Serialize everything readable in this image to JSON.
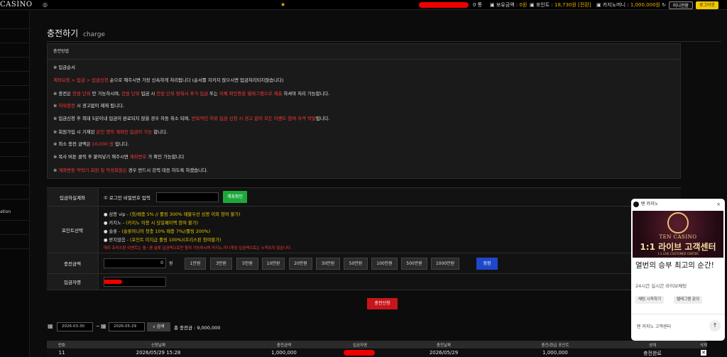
{
  "topbar": {
    "logo": "CASINO",
    "user_suffix": "0 통",
    "balance_label": "보유금액 :",
    "balance_value": "0원",
    "point_label": "포인트 :",
    "point_value": "18,730원 [전환]",
    "casino_label": "카지노머니 :",
    "casino_value": "1,000,000원",
    "mini_btn": "미니전환",
    "logout_btn": "로그아웃"
  },
  "sidebar": {
    "items": [
      "ation"
    ]
  },
  "page": {
    "title": "충전하기",
    "subtitle": "charge"
  },
  "notice": {
    "head": "충전방법",
    "l0": "※ 입금순서",
    "l1a": "계좌요청 > 입금 > 입금신청",
    "l1b": " 순으로 해주시면 가장 신속하게 처리됩니다 (순서를 지키지 않으시면 입금처리되지않습니다)",
    "l2a": "※ 충전은 ",
    "l2b": "만원 단위",
    "l2c": " 만 가능하시며, ",
    "l2d": "천원 단위",
    "l2e": " 입금 시 ",
    "l2f": "만원 단위 맞춰서 추가 입금",
    "l2g": " 또는 ",
    "l2h": "이체 확인증을 텔레그램으로 제출",
    "l2i": " 하셔야 처리 가능합니다.",
    "l3a": "※ ",
    "l3b": "허위충전",
    "l3c": " 시 경고없이 제재 됩니다.",
    "l4a": "※ 입금신청 후 최대 5분이내 입금이 완료되지 않을 경우 자동 취소 되며, ",
    "l4b": "반복적인 허위 입금 신청 시 경고 없이 모든 이벤트 참여 자격 박탈",
    "l4c": "됩니다.",
    "l5a": "※ 회원가입 시 기재된 ",
    "l5b": "본인 명의 계좌만 입금이 가능",
    "l5c": " 합니다.",
    "l6a": "※ 최소 충전 금액은 ",
    "l6b": "10,000 원",
    "l6c": " 입니다.",
    "l7a": "※ 복사 버튼 클릭 후 붙여넣기 해주시면 ",
    "l7b": "계좌번호",
    "l7c": " 가 확인 가능합니다",
    "l8a": "※ ",
    "l8b": "계좌변동 악박기 회원 및 악성회원은",
    "l8c": " 경우 반드시 강력 대응 하도록 하겠습니다."
  },
  "form": {
    "account_label": "입금하실계좌",
    "pw_label": "① 로그인 비밀번호 입력",
    "pw_value": "",
    "account_btn": "계좌확인",
    "point_label": "포인트선택",
    "opt1a": "● 삼봉 vip - ",
    "opt1b": "(첫/매충 5% // 롤링 300% 매불우선 삼봉 이외 참여 불가)",
    "opt2a": "● 카지노 - ",
    "opt2b": "(카지노 이용 시 당일페이백 참여 불가)",
    "opt3a": "● 슬롯 - ",
    "opt3b": "(슬롯머니아 첫충 10% 매충 7%//롤링 200%)",
    "opt4a": "● 받지않음 - ",
    "opt4b": "(포인트 미지급 롤링 100%)(프리스핀 참여불가)",
    "opt5": "매주 프리스핀 이벤트는 월~쿰 슬롯 입금액으로만 참여 가능하시며 카지노,미니게임 입금액으로는 누적되지 않습니다.",
    "amount_label": "충전금액",
    "amount_value": "0",
    "amount_unit": "원",
    "amount_buttons": [
      "1만원",
      "3만원",
      "5만원",
      "10만원",
      "20만원",
      "30만원",
      "50만원",
      "100만원",
      "500만원",
      "1000만원"
    ],
    "reset_btn": "정정",
    "depositor_label": "입금자명",
    "depositor_value": ""
  },
  "submit_btn": "충전신청",
  "search": {
    "from": "2026-03-30",
    "tilde": "~",
    "to": "2026-05-29",
    "btn": "검색",
    "total_label": "총 충전금 :",
    "total_value": "9,000,000"
  },
  "table": {
    "headers": [
      "번호",
      "신청날짜",
      "충전금액",
      "입금자명",
      "충전날짜",
      "충전/환급 포인트",
      "상태",
      "삭제"
    ],
    "rows": [
      {
        "no": "11",
        "req_date": "2026/05/29 15:28",
        "amount": "1,000,000",
        "charged_date": "2026/05/29",
        "points": "1,000,000",
        "status": "충전완료"
      }
    ]
  },
  "ad": {
    "header": "텐 카지노",
    "close": "×",
    "brand": "TEN CASINO",
    "banner_title": "1:1 라이브 고객센터",
    "banner_sub": "1:1 LIVE CUSTOMER CENTER",
    "title": "열번의 승부 최고의 순간!",
    "sub": "24시간 실시간 라이브채팅",
    "chip1": "채팅 시작하기",
    "chip2": "텔레그램 문의",
    "footer": "텐 카지노 고객센터"
  }
}
